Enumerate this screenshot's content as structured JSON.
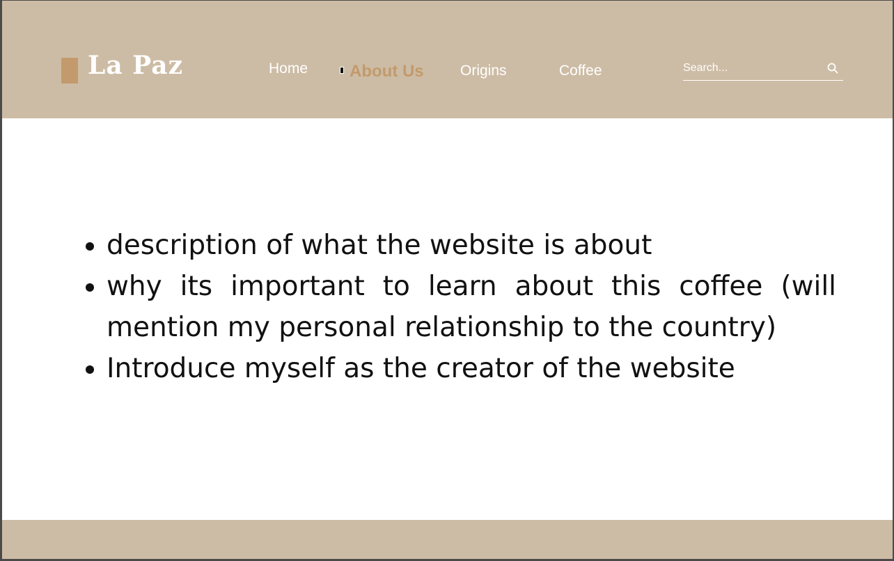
{
  "brand": {
    "name": "La Paz",
    "accent_color": "#c29a6c",
    "header_color": "#cdbca5"
  },
  "nav": {
    "items": [
      {
        "label": "Home",
        "active": false
      },
      {
        "label": "About Us",
        "active": true
      },
      {
        "label": "Origins",
        "active": false
      },
      {
        "label": "Coffee",
        "active": false
      }
    ]
  },
  "search": {
    "placeholder": "Search...",
    "icon": "search-icon"
  },
  "content": {
    "bullets": [
      "description of what the website is about",
      "why its important to learn about this coffee (will mention my personal relationship to the country)",
      "Introduce myself as the creator of the website"
    ]
  }
}
